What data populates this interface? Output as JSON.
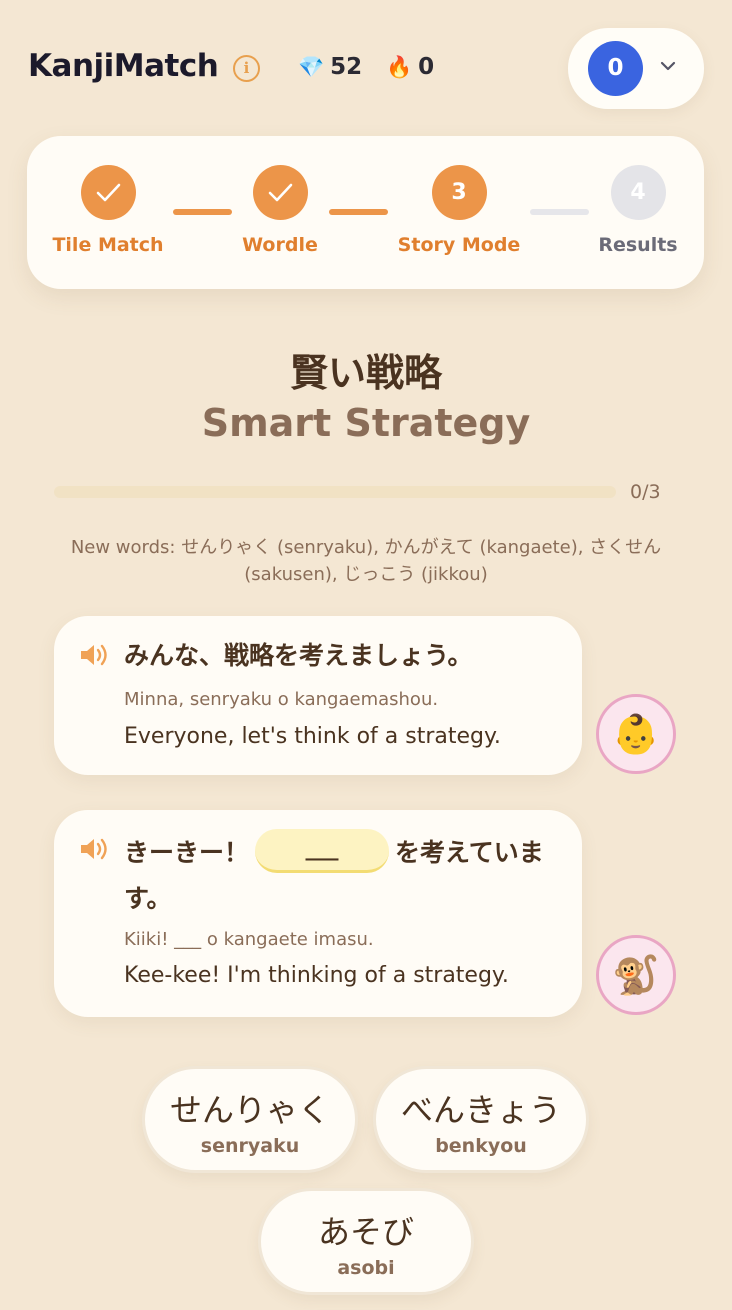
{
  "header": {
    "brand": "KanjiMatch",
    "info_icon": "i",
    "gems_icon": "💎",
    "gems": "52",
    "streak_icon": "🔥",
    "streak": "0",
    "user_avatar": "0"
  },
  "stepper": {
    "steps": [
      {
        "label": "Tile Match",
        "state": "done",
        "number": "✓"
      },
      {
        "label": "Wordle",
        "state": "done",
        "number": "✓"
      },
      {
        "label": "Story Mode",
        "state": "current",
        "number": "3"
      },
      {
        "label": "Results",
        "state": "todo",
        "number": "4"
      }
    ]
  },
  "story": {
    "title_jp": "賢い戦略",
    "title_en": "Smart Strategy",
    "progress_text": "0/3",
    "progress_fraction": 0,
    "new_words": "New words: せんりゃく (senryaku), かんがえて (kangaete), さくせん (sakusen), じっこう (jikkou)",
    "lines": [
      {
        "jp": "みんな、戦略を考えましょう。",
        "romaji": "Minna, senryaku o kangaemashou.",
        "english": "Everyone, let's think of a strategy.",
        "avatar": "👶"
      },
      {
        "jp_before": "きーきー！",
        "blank": "___",
        "jp_after": "を考えています。",
        "romaji": "Kiiki! ___ o kangaete imasu.",
        "english": "Kee-kee! I'm thinking of a strategy.",
        "avatar": "🐒"
      }
    ]
  },
  "choices": [
    {
      "kana": "せんりゃく",
      "romaji": "senryaku"
    },
    {
      "kana": "べんきょう",
      "romaji": "benkyou"
    },
    {
      "kana": "あそび",
      "romaji": "asobi"
    }
  ],
  "colors": {
    "background": "#f4e7d3",
    "accent": "#ec9549",
    "avatar_blue": "#3a64e0"
  }
}
